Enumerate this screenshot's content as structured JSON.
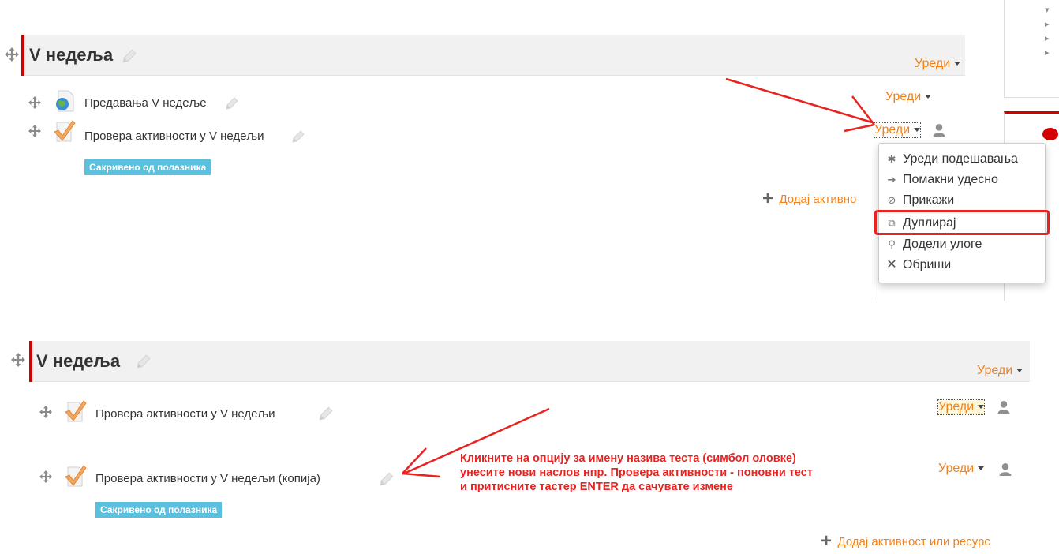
{
  "section": {
    "title": "V недеља",
    "edit_label": "Уреди"
  },
  "activities": {
    "lecture": "Предавања V недеље",
    "quiz": "Провера активности у V недељи",
    "quiz_copy": "Провера активности у V недељи (копија)",
    "edit_label": "Уреди",
    "hidden_badge": "Сакривено од полазника"
  },
  "add_activity": {
    "label_cut": "Додај активно",
    "label": "Додај активност или ресурс"
  },
  "menu": {
    "items": [
      {
        "label": "Уреди подешавања",
        "icon": "gear-icon"
      },
      {
        "label": "Помакни удесно",
        "icon": "arrow-right-icon"
      },
      {
        "label": "Прикажи",
        "icon": "eye-slash-icon"
      },
      {
        "label": "Дуплирај",
        "icon": "copy-icon"
      },
      {
        "label": "Додели улоге",
        "icon": "assign-role-icon"
      },
      {
        "label": "Обриши",
        "icon": "delete-x-icon"
      }
    ]
  },
  "annotation": {
    "lines": [
      "Кликните на опцију за имену назива теста (симбол оловке)",
      "унесите нови наслов нпр. Провера активности - поновни тест",
      "и притисните тастер ENTER да сачувате измене"
    ]
  },
  "colors": {
    "accent_orange": "#f0821e",
    "section_bar": "#d40000",
    "badge": "#5bc0de",
    "annotation_red": "#e8231f",
    "highlight_red": "#e8231f"
  }
}
